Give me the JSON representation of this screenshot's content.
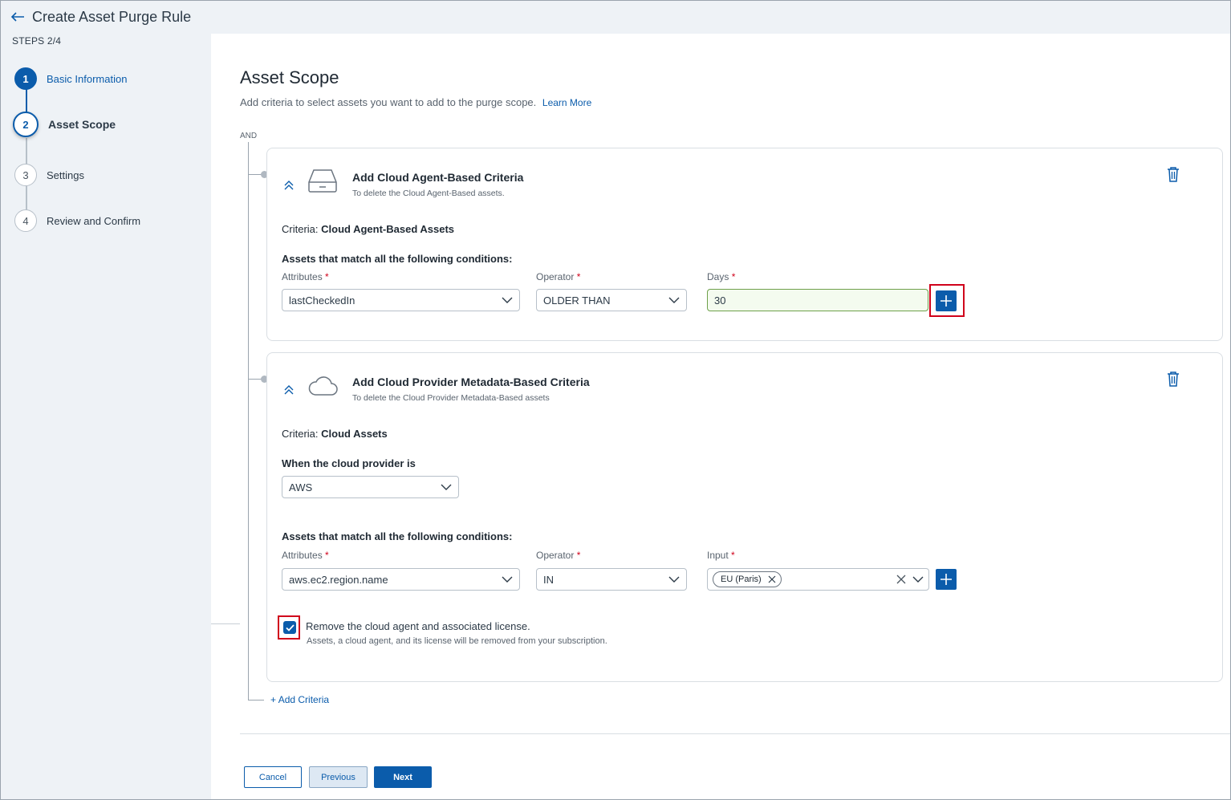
{
  "header": {
    "title": "Create Asset Purge Rule",
    "steps_label": "STEPS 2/4"
  },
  "stepper": {
    "steps": [
      {
        "number": "1",
        "label": "Basic Information"
      },
      {
        "number": "2",
        "label": "Asset Scope"
      },
      {
        "number": "3",
        "label": "Settings"
      },
      {
        "number": "4",
        "label": "Review and Confirm"
      }
    ]
  },
  "main": {
    "title": "Asset Scope",
    "subtitle": "Add criteria to select assets you want to add to the purge scope.",
    "learn_more": "Learn More",
    "logic_label": "AND",
    "add_criteria": "Add Criteria"
  },
  "card1": {
    "title": "Add Cloud Agent-Based Criteria",
    "description": "To delete the Cloud Agent-Based assets.",
    "criteria_prefix": "Criteria:",
    "criteria_value": "Cloud Agent-Based Assets",
    "conditions_heading": "Assets that match all the following conditions:",
    "attributes_label": "Attributes",
    "operator_label": "Operator",
    "days_label": "Days",
    "required_mark": "*",
    "attribute_value": "lastCheckedIn",
    "operator_value": "OLDER THAN",
    "days_value": "30"
  },
  "card2": {
    "title": "Add Cloud Provider Metadata-Based Criteria",
    "description": "To delete the Cloud Provider Metadata-Based assets",
    "criteria_prefix": "Criteria:",
    "criteria_value": "Cloud Assets",
    "provider_heading": "When the cloud provider is",
    "provider_value": "AWS",
    "conditions_heading": "Assets that match all the following conditions:",
    "attributes_label": "Attributes",
    "operator_label": "Operator",
    "input_label": "Input",
    "required_mark": "*",
    "attribute_value": "aws.ec2.region.name",
    "operator_value": "IN",
    "chip_value": "EU (Paris)",
    "checkbox_label": "Remove the cloud agent and associated license.",
    "checkbox_sub": "Assets, a cloud agent, and its license will be removed from your subscription.",
    "checkbox_checked": true
  },
  "footer": {
    "cancel": "Cancel",
    "previous": "Previous",
    "next": "Next"
  },
  "colors": {
    "accent": "#0b5cab",
    "highlight": "#d0021b",
    "valid_border": "#6ea04a"
  }
}
